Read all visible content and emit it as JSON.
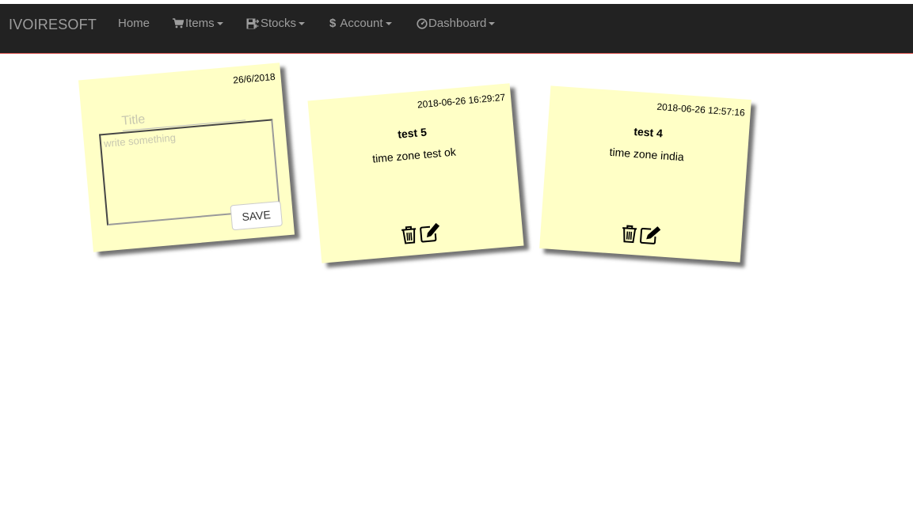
{
  "navbar": {
    "brand": "IVOIRESOFT",
    "items": [
      {
        "label": "Home",
        "icon": "",
        "dropdown": false
      },
      {
        "label": "Items",
        "icon": "shopping-cart-icon",
        "dropdown": true
      },
      {
        "label": "Stocks",
        "icon": "floppy-transfer-icon",
        "dropdown": true
      },
      {
        "label": "Account",
        "icon": "dollar-icon",
        "dropdown": true
      },
      {
        "label": "Dashboard",
        "icon": "dashboard-icon",
        "dropdown": true
      }
    ],
    "colors": {
      "background": "#222222",
      "text": "#9d9d9d",
      "bottom_border": "#d9534f"
    }
  },
  "new_note": {
    "date": "26/6/2018",
    "title_placeholder": "Title",
    "body_placeholder": "write something",
    "save_label": "SAVE"
  },
  "notes": [
    {
      "date": "2018-06-26 16:29:27",
      "title": "test 5",
      "body": "time zone test ok"
    },
    {
      "date": "2018-06-26 12:57:16",
      "title": "test 4",
      "body": "time zone india"
    }
  ],
  "note_color": "#ffffc6"
}
